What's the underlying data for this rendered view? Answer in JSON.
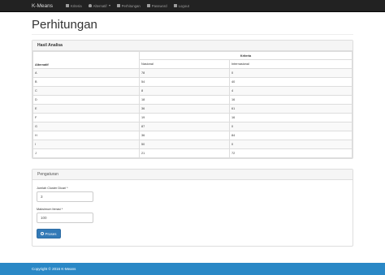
{
  "navbar": {
    "brand": "K-Means",
    "items": [
      {
        "label": "Kriteria",
        "icon": "list-icon"
      },
      {
        "label": "Alternatif",
        "icon": "user-icon",
        "dropdown": true
      },
      {
        "label": "Perhitungan",
        "icon": "calculator-icon"
      },
      {
        "label": "Password",
        "icon": "lock-icon"
      },
      {
        "label": "Logout",
        "icon": "logout-icon"
      }
    ]
  },
  "page": {
    "title": "Perhitungan"
  },
  "analysis": {
    "heading": "Hasil Analisa",
    "group_header": "Kriteria",
    "col_alternatif": "Alternatif",
    "col_1": "Nasional",
    "col_2": "Internasional",
    "rows": [
      [
        "A",
        "78",
        "0"
      ],
      [
        "B",
        "54",
        "40"
      ],
      [
        "C",
        "8",
        "4"
      ],
      [
        "D",
        "18",
        "16"
      ],
      [
        "E",
        "36",
        "61"
      ],
      [
        "F",
        "19",
        "16"
      ],
      [
        "G",
        "87",
        "0"
      ],
      [
        "H",
        "36",
        "84"
      ],
      [
        "I",
        "50",
        "0"
      ],
      [
        "J",
        "21",
        "72"
      ]
    ]
  },
  "settings": {
    "heading": "Pengaturan",
    "cluster_label": "Jumlah Cluster Dicari *",
    "cluster_value": "3",
    "iter_label": "Maksimum Iterasi *",
    "iter_value": "100",
    "submit_label": "Proses"
  },
  "footer": {
    "text": "Copyright © 2016 K-Means"
  }
}
